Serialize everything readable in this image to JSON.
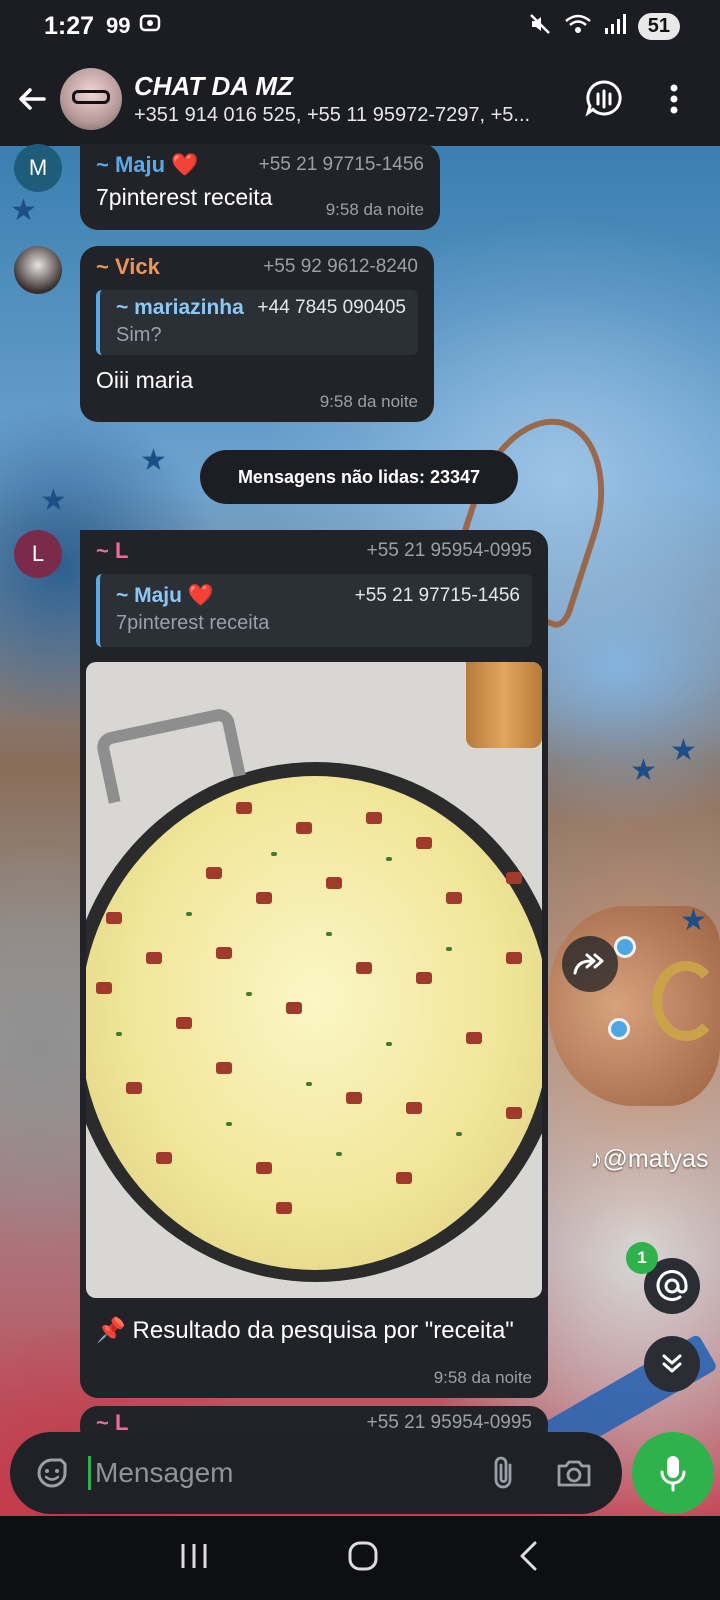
{
  "status_bar": {
    "time": "1:27",
    "notif_count_icon": "99",
    "battery": "51",
    "icons": [
      "quote-notification-icon",
      "screen-icon",
      "mute-icon",
      "wifi-icon",
      "signal-icon",
      "battery-icon"
    ]
  },
  "header": {
    "title": "CHAT DA MZ",
    "subtitle": "+351 914 016 525, +55 11 95972-7297, +5..."
  },
  "messages": [
    {
      "avatar_letter": "M",
      "avatar_color": "#1f5c7a",
      "sender": "~ Maju ❤️",
      "sender_color": "#5aa9e6",
      "phone": "+55 21 97715-1456",
      "text": "7pinterest receita",
      "time": "9:58 da noite"
    },
    {
      "sender": "~ Vick",
      "sender_color": "#f0945a",
      "phone": "+55 92 9612-8240",
      "reply": {
        "sender": "~ mariazinha",
        "phone": "+44 7845 090405",
        "text": "Sim?"
      },
      "text": "Oiii maria",
      "time": "9:58 da noite"
    },
    {
      "avatar_letter": "L",
      "avatar_color": "#7a2a4a",
      "sender": "~ L",
      "sender_color": "#ee6a9a",
      "phone": "+55 21 95954-0995",
      "reply": {
        "sender": "~ Maju ❤️",
        "phone": "+55 21 97715-1456",
        "text": "7pinterest receita"
      },
      "caption": "📌 Resultado da pesquisa por \"receita\"",
      "time": "9:58 da noite"
    },
    {
      "sender": "~ L",
      "phone": "+55 21 95954-0995"
    }
  ],
  "unread_label": "Mensagens não lidas: 23347",
  "watermark": "@matyas",
  "mention_badge": "1",
  "input": {
    "placeholder": "Mensagem"
  }
}
